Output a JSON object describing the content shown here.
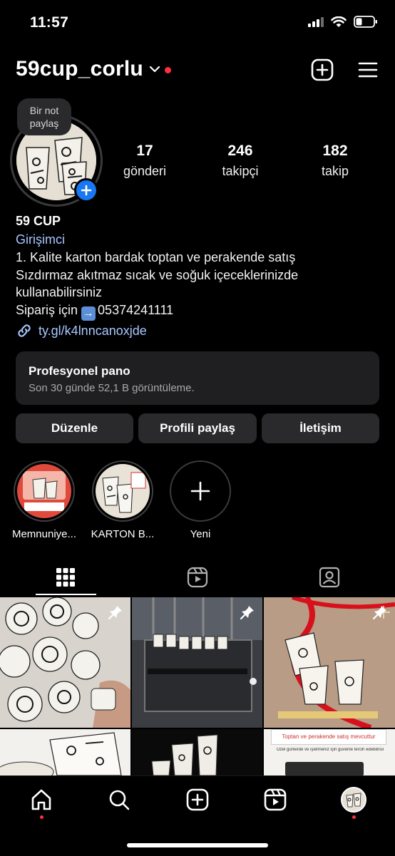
{
  "status_bar": {
    "time": "11:57"
  },
  "header": {
    "username": "59cup_corlu"
  },
  "profile": {
    "note_bubble": [
      "Bir not",
      "paylaş"
    ],
    "stats": [
      {
        "value": "17",
        "label": "gönderi"
      },
      {
        "value": "246",
        "label": "takipçi"
      },
      {
        "value": "182",
        "label": "takip"
      }
    ],
    "display_name": "59 CUP",
    "category": "Girişimci",
    "bio_lines": [
      "1. Kalite karton bardak toptan ve perakende satış",
      "Sızdırmaz akıtmaz sıcak ve soğuk içeceklerinizde",
      "kullanabilirsiniz"
    ],
    "bio_order_prefix": "Sipariş için",
    "bio_phone": "05374241111",
    "link": "ty.gl/k4lnncanoxjde"
  },
  "dashboard": {
    "title": "Profesyonel pano",
    "subtitle": "Son 30 günde 52,1 B görüntüleme."
  },
  "actions": {
    "edit": "Düzenle",
    "share": "Profili paylaş",
    "contact": "İletişim"
  },
  "highlights": [
    {
      "label": "Memnuniye..."
    },
    {
      "label": "KARTON B..."
    },
    {
      "label": "Yeni"
    }
  ],
  "tabs": [
    "grid-icon",
    "reels-icon",
    "tagged-icon"
  ],
  "grid_posts": [
    {
      "pinned": true
    },
    {
      "pinned": true
    },
    {
      "pinned": true
    },
    {
      "pinned": false
    },
    {
      "pinned": false
    },
    {
      "pinned": false,
      "text_top": "Toptan ve perakende satış mevcuttur",
      "text_sub": "Özel günlerde ve işletmeniz için güvenle tercih edebilirsiniz"
    }
  ],
  "bottom_nav": [
    "home-icon",
    "search-icon",
    "create-icon",
    "reels-icon",
    "profile-avatar"
  ],
  "colors": {
    "accent_blue": "#1877f2",
    "link_blue": "#a7c7ff",
    "notification_red": "#ff3040",
    "card_bg": "#1f1f22"
  }
}
